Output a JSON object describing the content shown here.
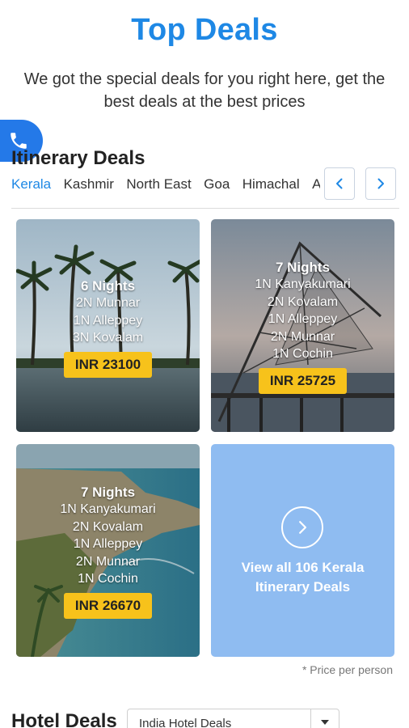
{
  "header": {
    "title": "Top Deals",
    "subtitle": "We got the special deals for you right here, get the best deals at the best prices"
  },
  "call_button": {
    "icon": "phone-icon"
  },
  "itinerary": {
    "title": "Itinerary Deals",
    "tabs": [
      "Kerala",
      "Kashmir",
      "North East",
      "Goa",
      "Himachal",
      "A"
    ],
    "active_tab": "Kerala",
    "prev_icon": "chevron-left-icon",
    "next_icon": "chevron-right-icon"
  },
  "deals": [
    {
      "nights": "6 Nights",
      "stops": [
        "2N Munnar",
        "1N Alleppey",
        "3N Kovalam"
      ],
      "price": "INR 23100"
    },
    {
      "nights": "7 Nights",
      "stops": [
        "1N Kanyakumari",
        "2N Kovalam",
        "1N Alleppey",
        "2N Munnar",
        "1N Cochin"
      ],
      "price": "INR 25725"
    },
    {
      "nights": "7 Nights",
      "stops": [
        "1N Kanyakumari",
        "2N Kovalam",
        "1N Alleppey",
        "2N Munnar",
        "1N Cochin"
      ],
      "price": "INR 26670"
    }
  ],
  "view_all": {
    "text": "View all 106 Kerala Itinerary Deals",
    "icon": "chevron-right-icon"
  },
  "price_note": "* Price per person",
  "hotel": {
    "title": "Hotel Deals",
    "select_value": "India Hotel Deals",
    "caret_icon": "caret-down-icon"
  },
  "colors": {
    "accent": "#1e88e5",
    "price_badge": "#f7c21b",
    "view_all_bg": "#8fbcf1"
  }
}
